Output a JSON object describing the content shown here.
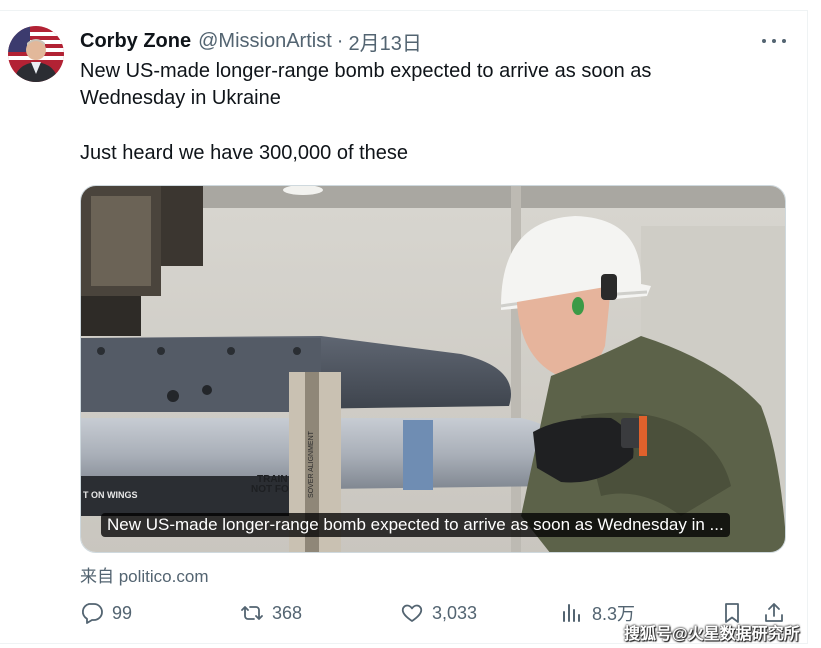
{
  "tweet": {
    "author_name": "Corby Zone",
    "handle": "@MissionArtist",
    "separator": "·",
    "date": "2月13日",
    "text_line1": "New US-made longer-range bomb expected to arrive as soon as",
    "text_line2": "Wednesday in Ukraine",
    "text_line3": "Just heard we have 300,000 of these"
  },
  "card": {
    "caption": "New US-made longer-range bomb expected to arrive as soon as Wednesday in ...",
    "source": "来自 politico.com",
    "image_text_left": "T ON WINGS",
    "image_text_trainer_1": "TRAIN",
    "image_text_trainer_2": "NOT FO",
    "image_text_vertical": "SOVER ALIGNMENT"
  },
  "actions": {
    "replies": "99",
    "retweets": "368",
    "likes": "3,033",
    "views": "8.3万"
  },
  "icons": {
    "more": "more-dots-icon",
    "reply": "reply-icon",
    "retweet": "retweet-icon",
    "like": "heart-icon",
    "views": "views-icon",
    "bookmark": "bookmark-icon",
    "share": "share-icon"
  },
  "watermark": "搜狐号@火星数据研究所",
  "colors": {
    "text_primary": "#0f1419",
    "text_secondary": "#536471",
    "border": "#cfd9de"
  }
}
